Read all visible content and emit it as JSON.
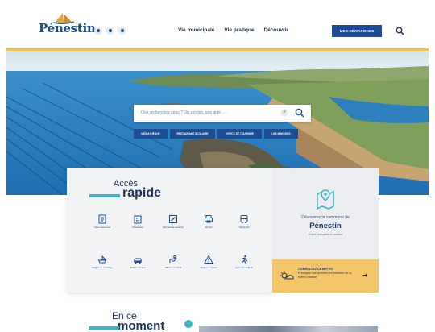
{
  "brand": {
    "name": "Pénestin"
  },
  "social": [
    "facebook-icon",
    "youtube-icon",
    "instagram-icon"
  ],
  "nav": {
    "items": [
      "Vie municipale",
      "Vie pratique",
      "Découvrir"
    ]
  },
  "header": {
    "cta_label": "MES DÉMARCHES"
  },
  "hero": {
    "search_placeholder": "Que recherchez-vous ? Un service, une aide, ...",
    "chips": [
      "MÉDIATHÈQUE",
      "RESTAURANT SCOLAIRE",
      "OFFICE DE TOURISME",
      "LES MARCHÉS"
    ]
  },
  "quick_access": {
    "title_line1": "Accès",
    "title_line2": "rapide",
    "tiles": [
      {
        "label": "Actes d'état civil",
        "icon": "document-icon"
      },
      {
        "label": "Urbanisme",
        "icon": "building-icon"
      },
      {
        "label": "Démarches scolaires",
        "icon": "school-icon"
      },
      {
        "label": "Permis",
        "icon": "printer-icon"
      },
      {
        "label": "Transports",
        "icon": "bus-icon"
      },
      {
        "label": "Règles du mouillage",
        "icon": "boat-icon"
      },
      {
        "label": "Environnement",
        "icon": "car-icon"
      },
      {
        "label": "Affaires sociales",
        "icon": "hand-icon"
      },
      {
        "label": "Risques majeurs",
        "icon": "warning-icon"
      },
      {
        "label": "Jeunesse & Sport",
        "icon": "run-icon"
      }
    ]
  },
  "discover": {
    "line1": "Découvrez la commune de",
    "name": "Pénestin",
    "subtitle": "Entre estuaire et océan"
  },
  "meteo": {
    "title": "CONSULTEZ LA MÉTÉO",
    "text": "Prévoyez vos activités en fonction de la météo marine",
    "arrow": "➜"
  },
  "section": {
    "title_line1": "En ce",
    "title_line2": "moment"
  },
  "colors": {
    "primary": "#1b4c94",
    "accent": "#41b3c6",
    "meteo": "#f4c66a",
    "text": "#1d3557"
  }
}
